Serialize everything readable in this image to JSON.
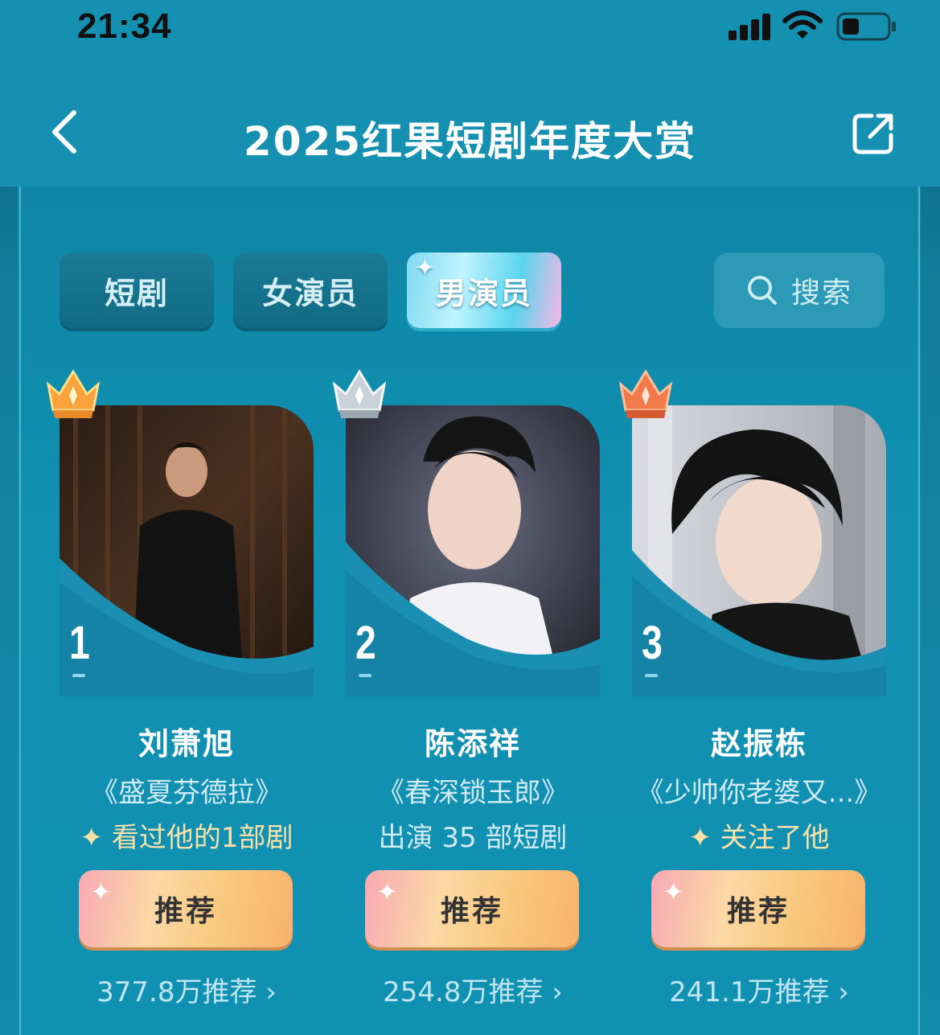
{
  "status_bar": {
    "time": "21:34",
    "icons": [
      "signal-icon",
      "wifi-icon",
      "battery-icon"
    ]
  },
  "header": {
    "title": "2025红果短剧年度大赏",
    "back_icon": "chevron-left-icon",
    "share_icon": "share-icon"
  },
  "tabs": [
    {
      "label": "短剧",
      "active": false
    },
    {
      "label": "女演员",
      "active": false
    },
    {
      "label": "男演员",
      "active": true
    }
  ],
  "search": {
    "label": "搜索",
    "icon": "search-icon"
  },
  "cards": [
    {
      "rank": "1",
      "crown": "gold",
      "name": "刘萧旭",
      "drama": "《盛夏芬德拉》",
      "relation_mark": "✦",
      "relation": "看过他的1部剧",
      "button": "推荐",
      "count": "377.8万推荐",
      "count_arrow": "›"
    },
    {
      "rank": "2",
      "crown": "silver",
      "name": "陈添祥",
      "drama": "《春深锁玉郎》",
      "relation_mark": "",
      "relation": "出演 35 部短剧",
      "button": "推荐",
      "count": "254.8万推荐",
      "count_arrow": "›"
    },
    {
      "rank": "3",
      "crown": "bronze",
      "name": "赵振栋",
      "drama": "《少帅你老婆又...》",
      "relation_mark": "✦",
      "relation": "关注了他",
      "button": "推荐",
      "count": "241.1万推荐",
      "count_arrow": "›"
    }
  ],
  "colors": {
    "background": "#128cab",
    "header": "#1590b0",
    "gold_text": "#f7e1a8",
    "button_gradient": [
      "#f7a9b4",
      "#fbd8a5",
      "#f9c97f",
      "#f8b26b"
    ]
  }
}
